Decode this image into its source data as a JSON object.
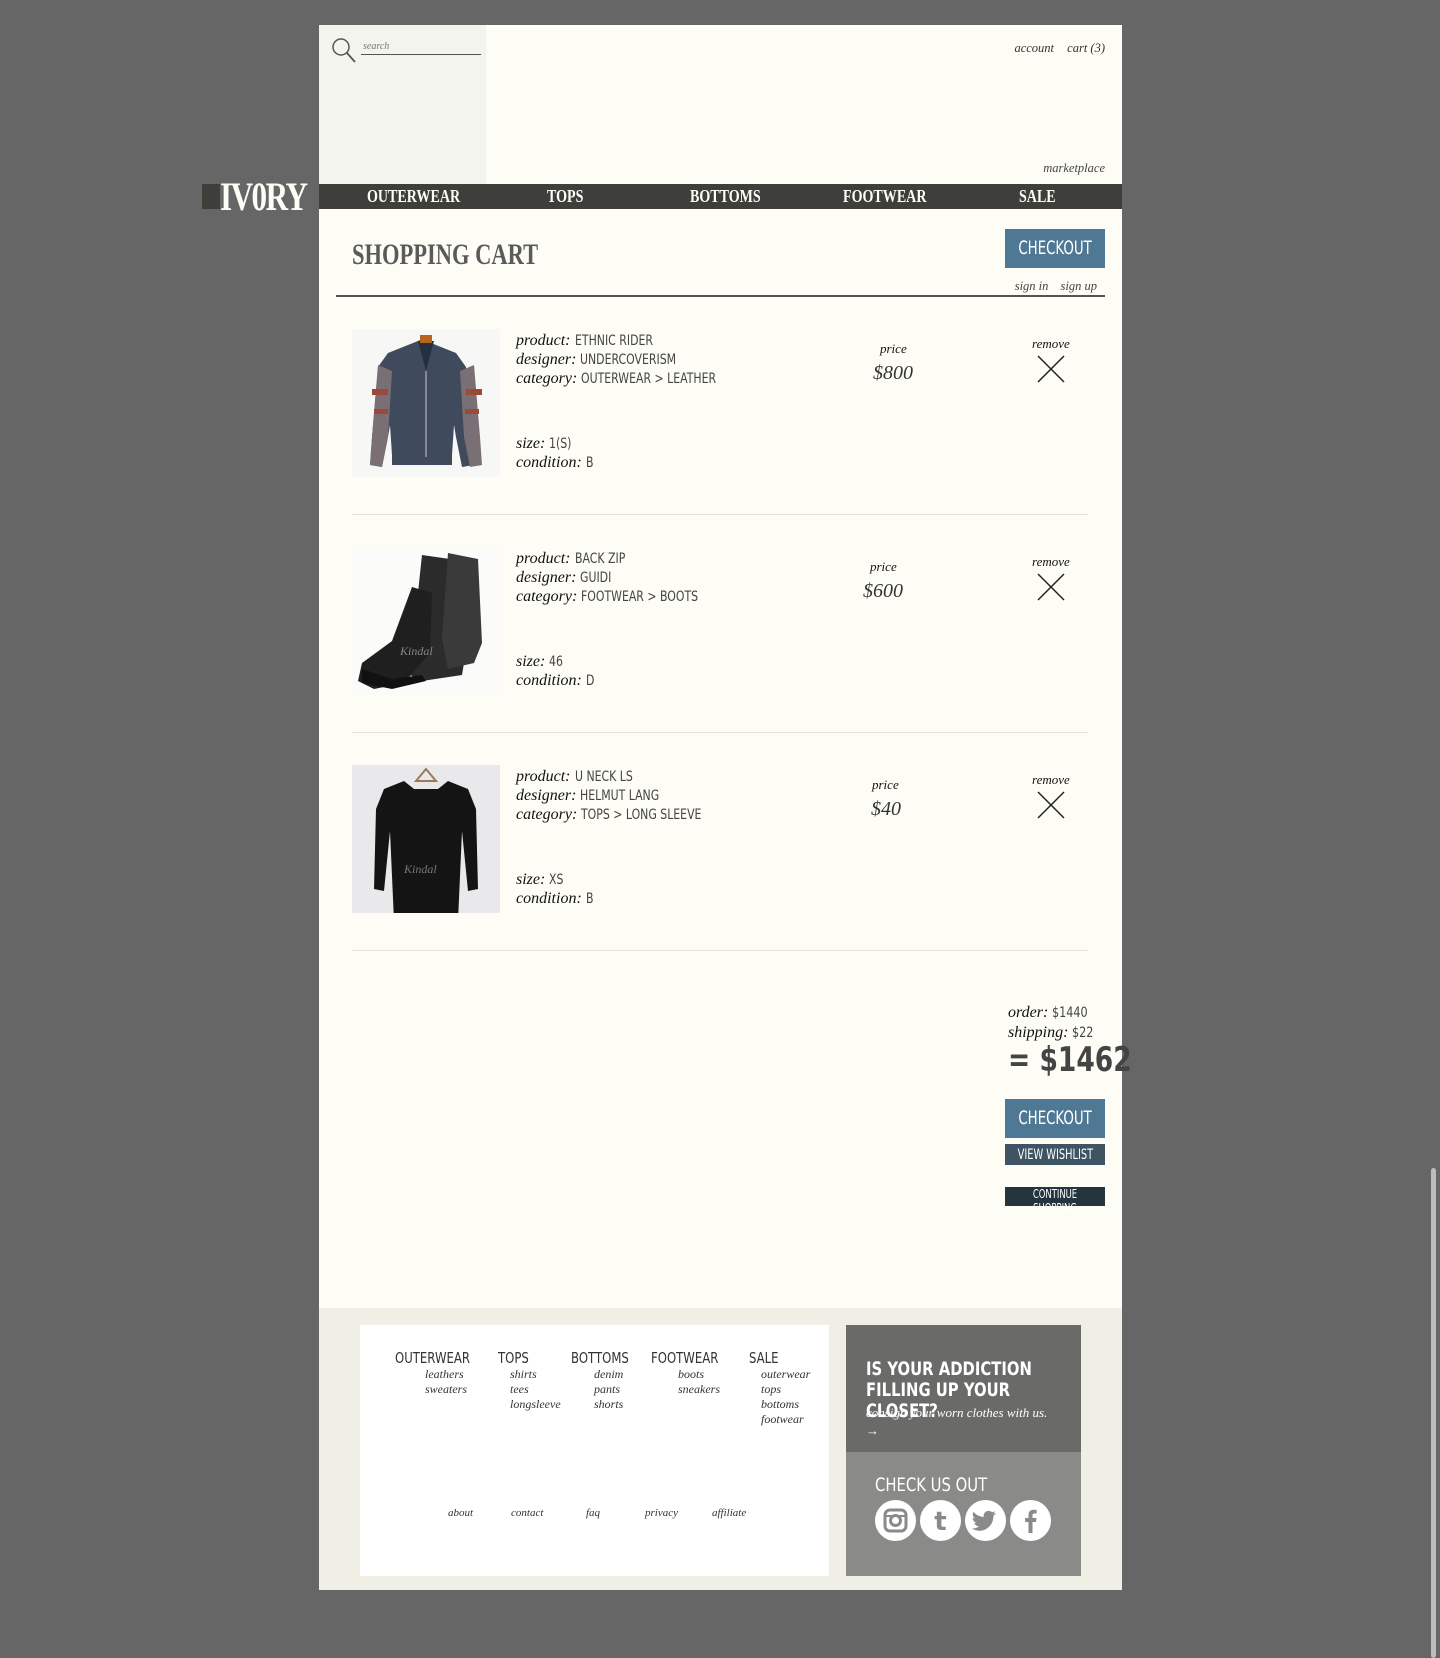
{
  "header": {
    "search_placeholder": "search",
    "account": "account",
    "cart": "cart (3)",
    "marketplace": "marketplace",
    "logo": "IV0RY"
  },
  "nav": [
    "OUTERWEAR",
    "TOPS",
    "BOTTOMS",
    "FOOTWEAR",
    "SALE"
  ],
  "cart": {
    "title": "SHOPPING CART",
    "checkout": "CHECKOUT",
    "sign_in": "sign in",
    "sign_up": "sign up",
    "labels": {
      "product": "product:",
      "designer": "designer:",
      "category": "category:",
      "size": "size:",
      "condition": "condition:",
      "price": "price",
      "remove": "remove"
    },
    "items": [
      {
        "product": "ETHNIC RIDER",
        "designer": "UNDERCOVERISM",
        "category": "OUTERWEAR > LEATHER",
        "size": "1(S)",
        "condition": "B",
        "price": "$800",
        "thumb_icon": "leather-jacket-photo"
      },
      {
        "product": "BACK ZIP",
        "designer": "GUIDI",
        "category": "FOOTWEAR > BOOTS",
        "size": "46",
        "condition": "D",
        "price": "$600",
        "thumb_icon": "boots-photo"
      },
      {
        "product": "U NECK LS",
        "designer": "HELMUT LANG",
        "category": "TOPS > LONG SLEEVE",
        "size": "XS",
        "condition": "B",
        "price": "$40",
        "thumb_icon": "long-sleeve-photo"
      }
    ],
    "summary": {
      "order_label": "order:",
      "order": "$1440",
      "shipping_label": "shipping:",
      "shipping": "$22",
      "total": "= $1462"
    },
    "buttons": {
      "checkout": "CHECKOUT",
      "wishlist": "VIEW WISHLIST",
      "continue": "CONTINUE SHOPPING"
    }
  },
  "footer": {
    "columns": [
      {
        "head": "OUTERWEAR",
        "subs": [
          "leathers",
          "sweaters"
        ]
      },
      {
        "head": "TOPS",
        "subs": [
          "shirts",
          "tees",
          "longsleeve"
        ]
      },
      {
        "head": "BOTTOMS",
        "subs": [
          "denim",
          "pants",
          "shorts"
        ]
      },
      {
        "head": "FOOTWEAR",
        "subs": [
          "boots",
          "sneakers"
        ]
      },
      {
        "head": "SALE",
        "subs": [
          "outerwear",
          "tops",
          "bottoms",
          "footwear"
        ]
      }
    ],
    "links": [
      "about",
      "contact",
      "faq",
      "privacy",
      "affiliate"
    ],
    "promo": {
      "heading": "IS YOUR ADDICTION FILLING UP YOUR CLOSET?",
      "sub": "consign your worn clothes with us.",
      "arrow": "→"
    },
    "social": {
      "heading": "CHECK US OUT",
      "icons": [
        "instagram-icon",
        "tumblr-icon",
        "twitter-icon",
        "facebook-icon"
      ]
    }
  },
  "colors": {
    "accent": "#4e7894",
    "dark_nav": "#3e3e3b",
    "background": "#666666",
    "page": "#fdfdf6"
  }
}
